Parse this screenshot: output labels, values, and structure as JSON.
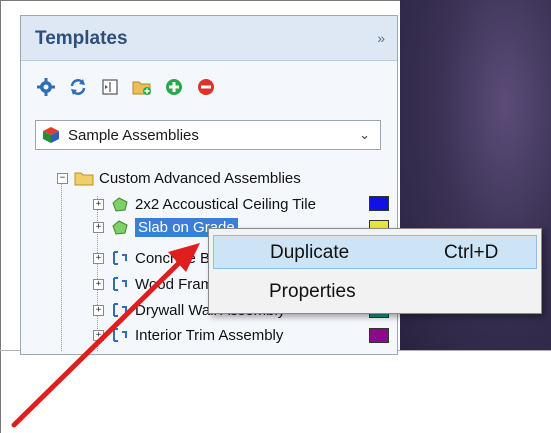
{
  "panel": {
    "title": "Templates",
    "collapse_glyph": "»"
  },
  "toolbar": {
    "icons": [
      "gear-icon",
      "refresh-icon",
      "expand-collapse-icon",
      "add-folder-icon",
      "add-icon",
      "remove-icon"
    ]
  },
  "source_select": {
    "value": "Sample Assemblies",
    "icon": "cube-icon"
  },
  "tree": {
    "root": {
      "label": "Custom Advanced Assemblies",
      "expander": "−"
    },
    "items": [
      {
        "label": "2x2 Accoustical Ceiling Tile",
        "expander": "+",
        "color": "#1010e8",
        "icon": "green-shape-icon"
      },
      {
        "label": "Slab on Grade",
        "expander": "+",
        "color": "#e8e63a",
        "icon": "green-shape-icon",
        "selected": true
      },
      {
        "label": "Concrete Block Wall",
        "expander": "+",
        "color": "#d9d9d9",
        "icon": "blue-bracket-icon"
      },
      {
        "label": "Wood Frame Wall",
        "expander": "+",
        "color": "#d9d9d9",
        "icon": "blue-bracket-icon"
      },
      {
        "label": "Drywall Wall Assembly",
        "expander": "+",
        "color": "#1a8f8a",
        "icon": "blue-bracket-icon"
      },
      {
        "label": "Interior Trim Assembly",
        "expander": "+",
        "color": "#8a0a8a",
        "icon": "blue-bracket-icon"
      }
    ]
  },
  "context_menu": {
    "items": [
      {
        "label": "Duplicate",
        "shortcut": "Ctrl+D",
        "highlighted": true
      },
      {
        "label": "Properties",
        "shortcut": ""
      }
    ]
  },
  "colors": {
    "accent": "#3a7fd6",
    "arrow": "#e01e1e"
  }
}
